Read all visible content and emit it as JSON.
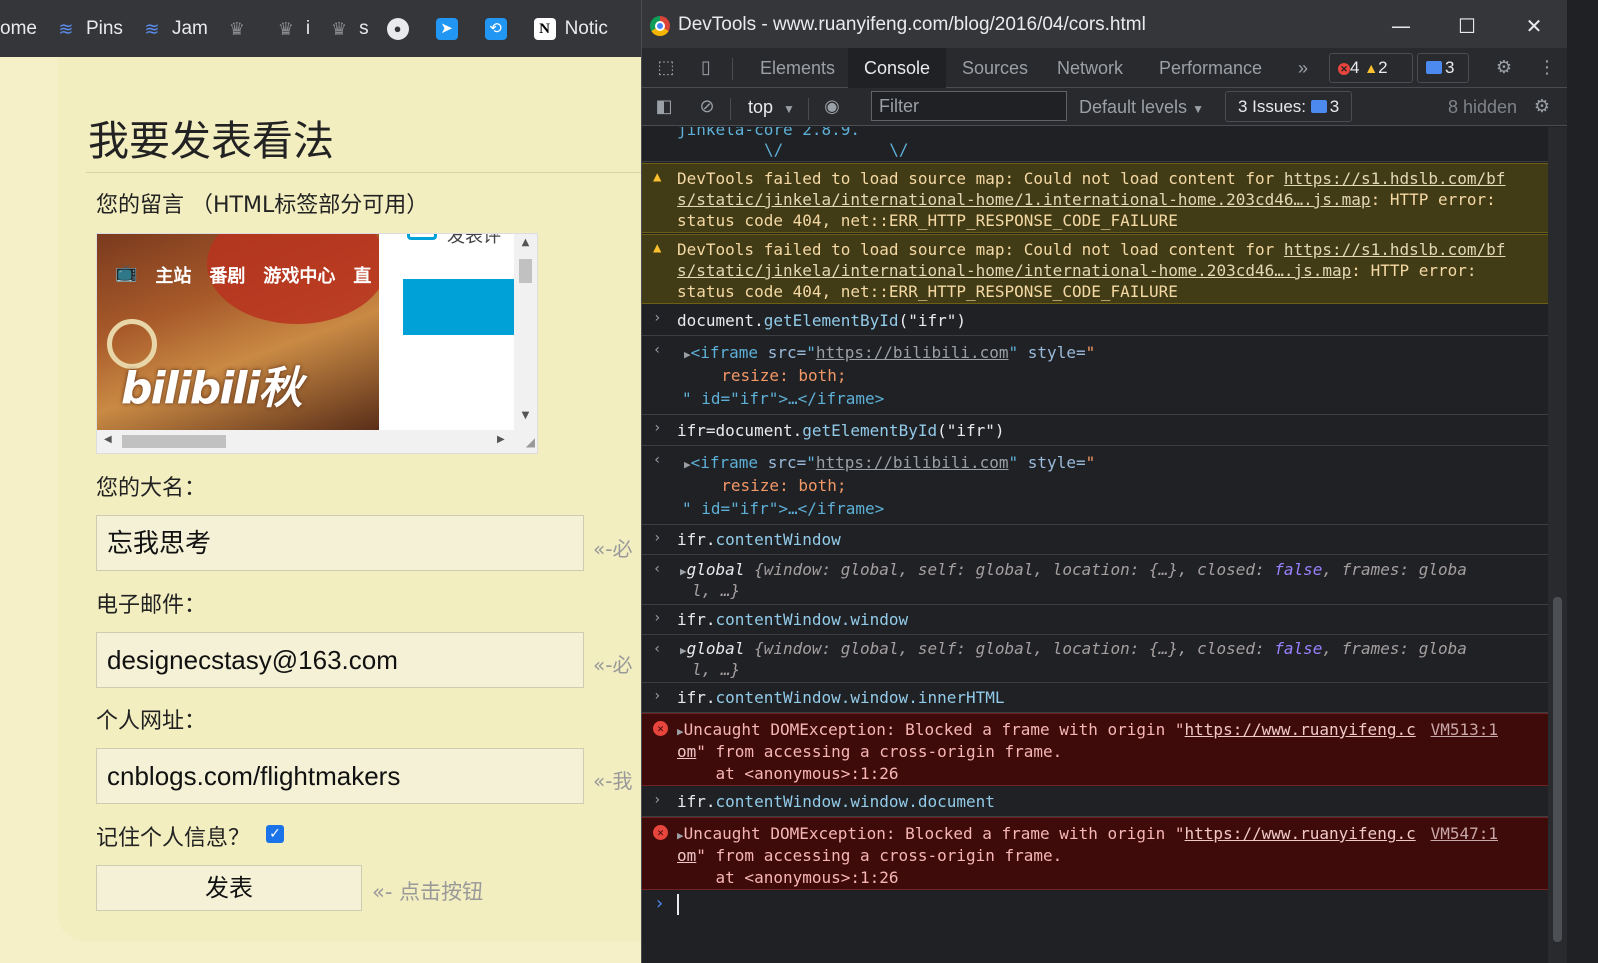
{
  "bookmarks": [
    {
      "label": "ome",
      "icon": "none"
    },
    {
      "label": "Pins",
      "icon": "pins-icon"
    },
    {
      "label": "Jam",
      "icon": "pins-icon"
    },
    {
      "label": "",
      "icon": "hat-icon"
    },
    {
      "label": "i",
      "icon": "hat-icon"
    },
    {
      "label": "s",
      "icon": "hat-icon"
    },
    {
      "label": "",
      "icon": "github-icon"
    },
    {
      "label": "",
      "icon": "send-icon"
    },
    {
      "label": "",
      "icon": "sync-icon"
    },
    {
      "label": "Notic",
      "icon": "notion-icon"
    }
  ],
  "page": {
    "heading": "我要发表看法",
    "comment_label": "您的留言 （HTML标签部分可用）",
    "iframe": {
      "nav": [
        "主站",
        "番剧",
        "游戏中心",
        "直"
      ],
      "logo": "bilibili秋",
      "side_peek": "发表评"
    },
    "name_label": "您的大名：",
    "name_value": "忘我思考",
    "name_hint": "«-必",
    "email_label": "电子邮件：",
    "email_value": "designecstasy@163.com",
    "email_hint": "«-必",
    "url_label": "个人网址：",
    "url_value": "cnblogs.com/flightmakers",
    "url_hint": "«-我",
    "remember_label": "记住个人信息？",
    "remember_checked": true,
    "submit_label": "发表",
    "submit_hint": "«- 点击按钮"
  },
  "devtools": {
    "title": "DevTools - www.ruanyifeng.com/blog/2016/04/cors.html",
    "tabs": [
      "Elements",
      "Console",
      "Sources",
      "Network",
      "Performance"
    ],
    "active_tab": "Console",
    "more_tabs": "»",
    "error_count": "4",
    "warning_count": "2",
    "issue_badge_count": "3",
    "context": "top",
    "filter_placeholder": "Filter",
    "levels": "Default levels",
    "issues_label": "3 Issues:",
    "issues_count": "3",
    "hidden": "8 hidden"
  },
  "console": {
    "top_cut": "jinkela-core 2.8.9.",
    "top_cut2": "\\/           \\/",
    "warn1": {
      "prefix": "DevTools failed to load source map: Could not load content for ",
      "link1": "https://s1.hdslb.com/bf",
      "link2": "s/static/jinkela/international-home/1.international-home.203cd46….js.map",
      "suffix2": ": HTTP error:",
      "line3": "status code 404, net::ERR_HTTP_RESPONSE_CODE_FAILURE"
    },
    "warn2": {
      "prefix": "DevTools failed to load source map: Could not load content for ",
      "link1": "https://s1.hdslb.com/bf",
      "link2": "s/static/jinkela/international-home/international-home.203cd46….js.map",
      "suffix2": ": HTTP error:",
      "line3": "status code 404, net::ERR_HTTP_RESPONSE_CODE_FAILURE"
    },
    "in1": {
      "obj": "document.",
      "method": "getElementById",
      "arg": "(\"ifr\")"
    },
    "out1": {
      "open": "<iframe ",
      "src_attr": "src=",
      "src_val": "https://bilibili.com",
      "style_attr": " style=",
      "style_open": "\"",
      "style_body": "  resize: both;",
      "tail": "\" id=\"ifr\">…</iframe>"
    },
    "in2": {
      "obj": "ifr=document.",
      "method": "getElementById",
      "arg": "(\"ifr\")"
    },
    "out2": {
      "open": "<iframe ",
      "src_attr": "src=",
      "src_val": "https://bilibili.com",
      "style_attr": " style=",
      "style_open": "\"",
      "style_body": "  resize: both;",
      "tail": "\" id=\"ifr\">…</iframe>"
    },
    "in3": {
      "obj": "ifr.",
      "prop": "contentWindow"
    },
    "out3": {
      "head": "global ",
      "body1": "{window: global, self: global, location: {…}, closed: ",
      "false": "false",
      "body2": ", frames: globa",
      "line2": "l, …}"
    },
    "in4": {
      "obj": "ifr.",
      "prop": "contentWindow.window"
    },
    "out4": {
      "head": "global ",
      "body1": "{window: global, self: global, location: {…}, closed: ",
      "false": "false",
      "body2": ", frames: globa",
      "line2": "l, …}"
    },
    "in5": {
      "obj": "ifr.",
      "prop": "contentWindow.window.innerHTML"
    },
    "err1": {
      "text": "Uncaught DOMException: Blocked a frame with origin \"",
      "link": "https://www.ruanyifeng.c",
      "link2": "om",
      "line2": "\" from accessing a cross-origin frame.",
      "line3": "    at <anonymous>:1:26",
      "src": "VM513:1"
    },
    "in6": {
      "obj": "ifr.",
      "prop": "contentWindow.window.document"
    },
    "err2": {
      "text": "Uncaught DOMException: Blocked a frame with origin \"",
      "link": "https://www.ruanyifeng.c",
      "link2": "om",
      "line2": "\" from accessing a cross-origin frame.",
      "line3": "    at <anonymous>:1:26",
      "src": "VM547:1"
    }
  },
  "colors": {
    "page_bg": "#f2eec0",
    "devtools_bg": "#202124",
    "warning_bg": "#413b16",
    "error_bg": "#3e0a0a",
    "accent_blue": "#1a73e8",
    "bilibili_blue": "#00a1d6"
  }
}
